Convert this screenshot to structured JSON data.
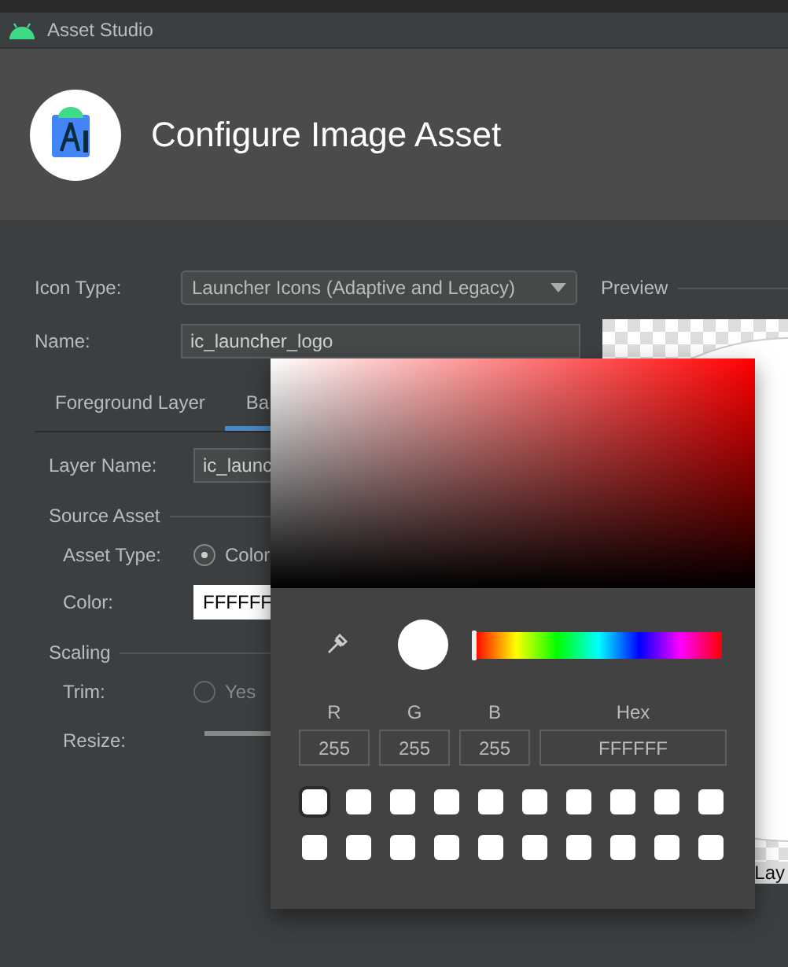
{
  "window": {
    "title": "Asset Studio"
  },
  "header": {
    "title": "Configure Image Asset"
  },
  "form": {
    "icon_type": {
      "label": "Icon Type:",
      "value": "Launcher Icons (Adaptive and Legacy)"
    },
    "name": {
      "label": "Name:",
      "value": "ic_launcher_logo"
    }
  },
  "tabs": [
    {
      "label": "Foreground Layer",
      "selected": false
    },
    {
      "label": "Ba",
      "selected": true
    }
  ],
  "layer": {
    "layer_name": {
      "label": "Layer Name:",
      "value": "ic_launc"
    },
    "source_asset": {
      "title": "Source Asset",
      "asset_type": {
        "label": "Asset Type:",
        "option": {
          "label": "Color",
          "selected": true
        }
      },
      "color": {
        "label": "Color:",
        "value": "FFFFFF"
      }
    },
    "scaling": {
      "title": "Scaling",
      "trim": {
        "label": "Trim:",
        "option": {
          "label": "Yes",
          "selected": false
        }
      },
      "resize": {
        "label": "Resize:",
        "level": 0.25
      }
    }
  },
  "preview": {
    "label": "Preview",
    "caption": "Lay"
  },
  "color_picker": {
    "hue": {
      "level": 0
    },
    "channels": [
      {
        "label": "R",
        "value": "255"
      },
      {
        "label": "G",
        "value": "255"
      },
      {
        "label": "B",
        "value": "255"
      },
      {
        "label": "Hex",
        "value": "FFFFFF"
      }
    ],
    "swatches": [
      {
        "color": "#ffffff",
        "selected": true
      },
      {
        "color": "#ffffff",
        "selected": false
      },
      {
        "color": "#ffffff",
        "selected": false
      },
      {
        "color": "#ffffff",
        "selected": false
      },
      {
        "color": "#ffffff",
        "selected": false
      },
      {
        "color": "#ffffff",
        "selected": false
      },
      {
        "color": "#ffffff",
        "selected": false
      },
      {
        "color": "#ffffff",
        "selected": false
      },
      {
        "color": "#ffffff",
        "selected": false
      },
      {
        "color": "#ffffff",
        "selected": false
      },
      {
        "color": "#ffffff",
        "selected": false
      },
      {
        "color": "#ffffff",
        "selected": false
      },
      {
        "color": "#ffffff",
        "selected": false
      },
      {
        "color": "#ffffff",
        "selected": false
      },
      {
        "color": "#ffffff",
        "selected": false
      },
      {
        "color": "#ffffff",
        "selected": false
      },
      {
        "color": "#ffffff",
        "selected": false
      },
      {
        "color": "#ffffff",
        "selected": false
      },
      {
        "color": "#ffffff",
        "selected": false
      },
      {
        "color": "#ffffff",
        "selected": false
      }
    ]
  }
}
